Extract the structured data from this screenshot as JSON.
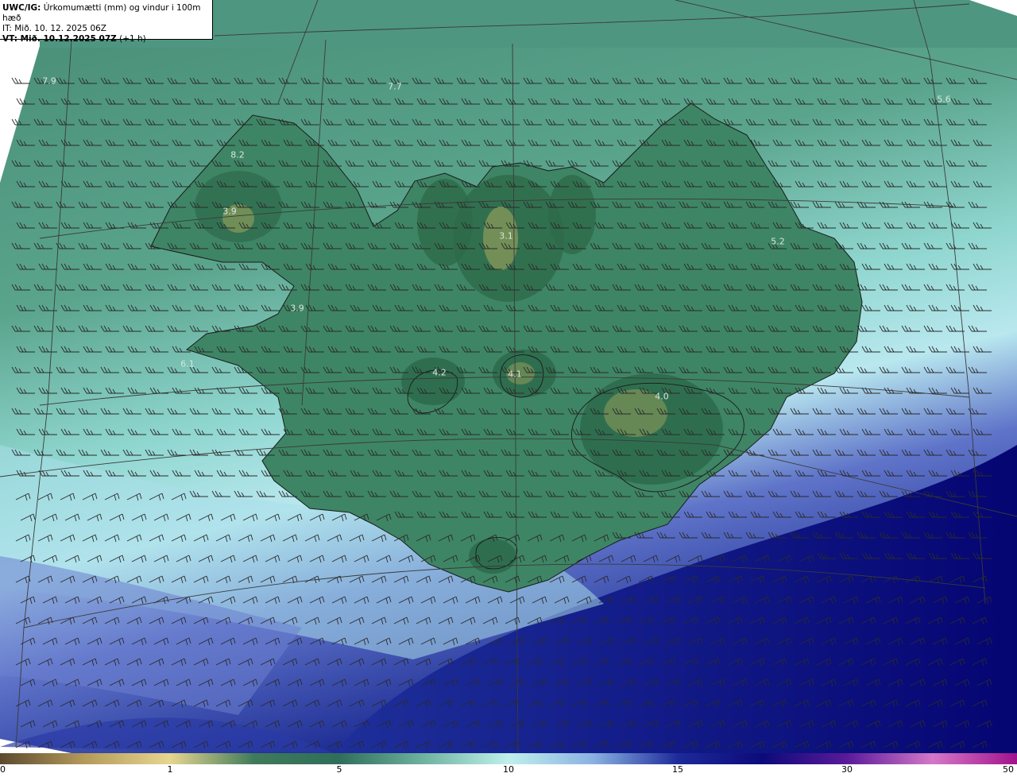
{
  "header": {
    "model": "UWC/IG:",
    "title": " Úrkomumætti (mm) og vindur i 100m hæð",
    "init_time": "IT: Mið. 10. 12. 2025 06Z",
    "valid_prefix": "VT: Mið. 10.12.2025 07Z",
    "valid_suffix": " (+1 h)"
  },
  "map_labels": [
    {
      "text": "7.9"
    },
    {
      "text": "7.7"
    },
    {
      "text": "5.6"
    },
    {
      "text": "8.2"
    },
    {
      "text": "3.9"
    },
    {
      "text": "3.1"
    },
    {
      "text": "5.2"
    },
    {
      "text": "3.9"
    },
    {
      "text": "6.1"
    },
    {
      "text": "4.2"
    },
    {
      "text": "4.1"
    },
    {
      "text": "4.0"
    }
  ],
  "colorbar": {
    "ticks": [
      "0",
      "1",
      "5",
      "10",
      "15",
      "30",
      "50"
    ],
    "colors": [
      "#5c4a2e",
      "#b49a5a",
      "#e6d690",
      "#3f7a5a",
      "#2f6e5a",
      "#6fb3a0",
      "#bff0ec",
      "#8ab2e2",
      "#1d2a9a",
      "#0c0a7a",
      "#5a1a9a",
      "#d478c8",
      "#a2128c"
    ]
  }
}
